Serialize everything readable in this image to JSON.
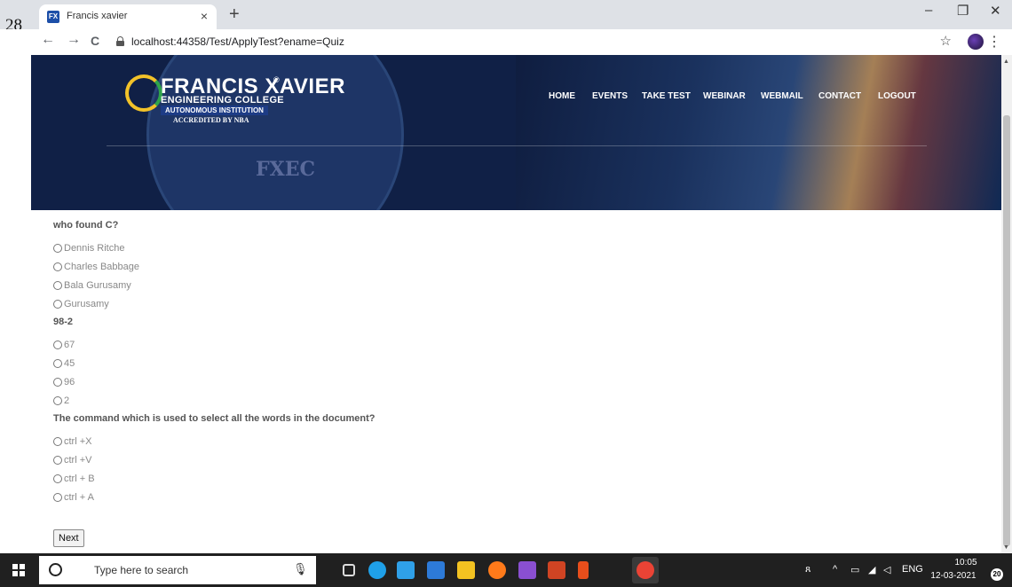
{
  "page_marker": "28",
  "browser": {
    "tab_title": "Francis xavier",
    "favicon_text": "FX",
    "tab_close": "×",
    "new_tab": "+",
    "url": "localhost:44358/Test/ApplyTest?ename=Quiz",
    "window_controls": {
      "minimize": "–",
      "restore": "❐",
      "close": "✕"
    },
    "nav": {
      "back": "←",
      "forward": "→",
      "reload": "C"
    },
    "bookmark_star": "☆",
    "menu": "⋮"
  },
  "header": {
    "brand": "FRANCIS XAVIER",
    "registered": "®",
    "subtitle": "ENGINEERING COLLEGE",
    "autonomous": "AUTONOMOUS INSTITUTION",
    "accreditation": "ACCREDITED BY NBA",
    "seal_text": "FXEC",
    "nav_items": [
      "HOME",
      "EVENTS",
      "TAKE TEST",
      "WEBINAR",
      "WEBMAIL",
      "CONTACT",
      "LOGOUT"
    ]
  },
  "quiz": {
    "questions": [
      {
        "text": "who found C?",
        "options": [
          "Dennis Ritche",
          "Charles Babbage",
          "Bala Gurusamy",
          "Gurusamy"
        ]
      },
      {
        "text": "98-2",
        "options": [
          "67",
          "45",
          "96",
          "2"
        ]
      },
      {
        "text": "The command which is used to select all the words in the document?",
        "options": [
          "ctrl +X",
          "ctrl +V",
          "ctrl + B",
          "ctrl + A"
        ]
      }
    ],
    "next_label": "Next"
  },
  "taskbar": {
    "search_placeholder": "Type here to search",
    "time": "10:05",
    "date": "12-03-2021",
    "language": "ENG",
    "notification_count": "20",
    "colors": {
      "edge": "#1fa0e8",
      "store": "#2fa0e8",
      "mail": "#2d7ad8",
      "explorer": "#f3c221",
      "firefox": "#ff7a1a",
      "vs": "#8a4fd1",
      "powerpoint": "#d04423",
      "chrome": "#ea4335"
    }
  }
}
